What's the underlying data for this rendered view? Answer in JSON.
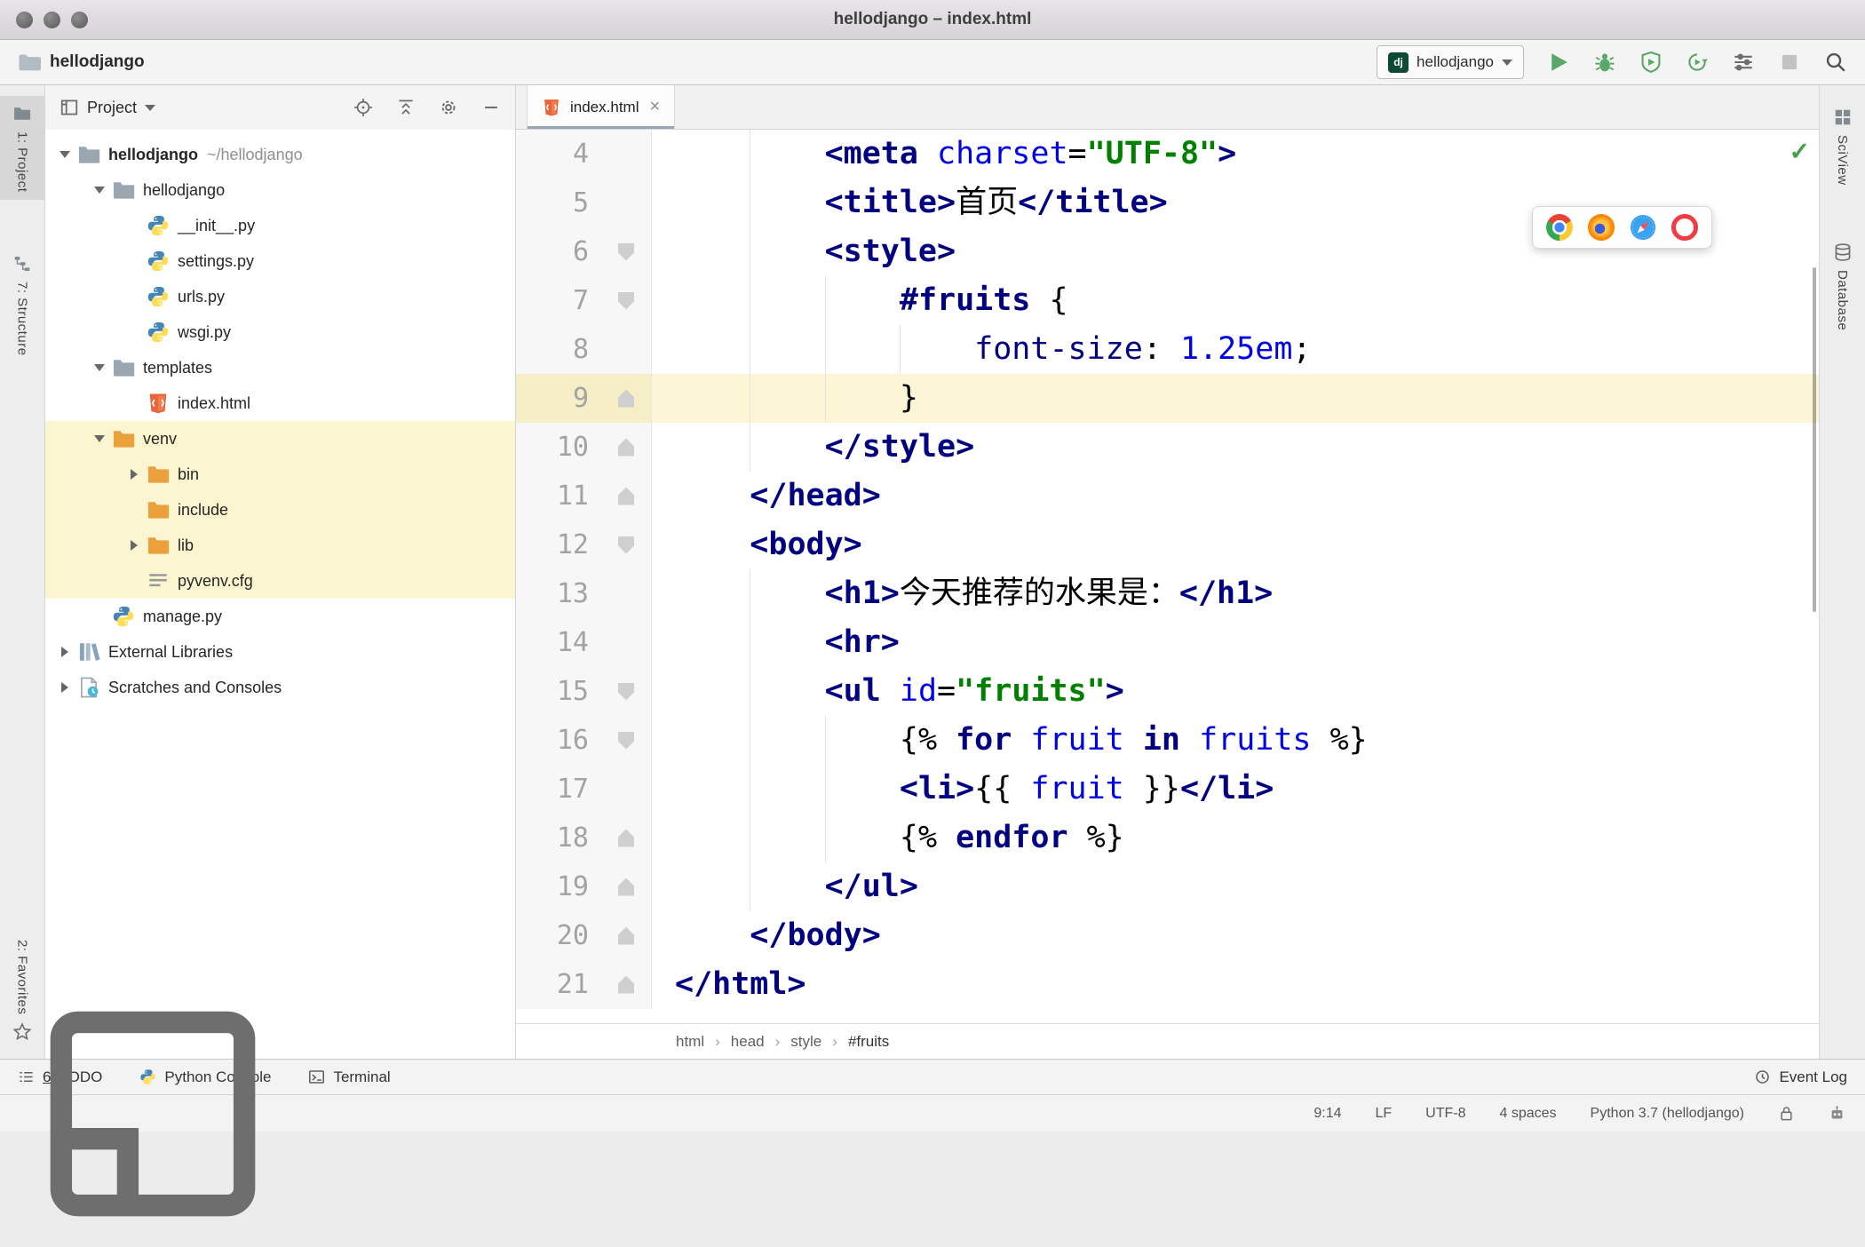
{
  "titlebar": {
    "title": "hellodjango – index.html"
  },
  "toolbar": {
    "project_name": "hellodjango",
    "run_config": {
      "label": "hellodjango",
      "badge": "dj"
    },
    "actions": [
      {
        "icon": "play",
        "name": "run-button"
      },
      {
        "icon": "debug",
        "name": "debug-button"
      },
      {
        "icon": "coverage",
        "name": "run-with-coverage-button"
      },
      {
        "icon": "profiler",
        "name": "profiler-button"
      },
      {
        "icon": "edit-configs",
        "name": "edit-configurations-button"
      },
      {
        "icon": "stop",
        "name": "stop-button",
        "disabled": true
      },
      {
        "icon": "search",
        "name": "search-everywhere-button"
      }
    ]
  },
  "left_strip": {
    "top": [
      {
        "icon": "project-tool",
        "label": "1: Project",
        "active": true
      },
      {
        "icon": "structure-tool",
        "label": "7: Structure"
      }
    ],
    "bottom": [
      {
        "icon": "star",
        "label": "2: Favorites",
        "icon_after": true
      }
    ]
  },
  "right_strip": {
    "items": [
      {
        "icon": "sciview-grid",
        "label": "SciView"
      },
      {
        "icon": "database",
        "label": "Database"
      }
    ]
  },
  "project_panel": {
    "header": {
      "title": "Project",
      "actions": [
        {
          "icon": "locate",
          "name": "locate-file-button"
        },
        {
          "icon": "collapse-all",
          "name": "collapse-all-button"
        },
        {
          "icon": "settings",
          "name": "settings-button"
        },
        {
          "icon": "hide",
          "name": "hide-panel-button"
        }
      ]
    },
    "tree": [
      {
        "label": "hellodjango",
        "suffix": "~/hellodjango",
        "icon": "folder",
        "level": 0,
        "arrow": "down",
        "bold": true
      },
      {
        "label": "hellodjango",
        "icon": "folder",
        "level": 1,
        "arrow": "down"
      },
      {
        "label": "__init__.py",
        "icon": "python",
        "level": 2
      },
      {
        "label": "settings.py",
        "icon": "python",
        "level": 2
      },
      {
        "label": "urls.py",
        "icon": "python",
        "level": 2
      },
      {
        "label": "wsgi.py",
        "icon": "python",
        "level": 2
      },
      {
        "label": "templates",
        "icon": "folder",
        "level": 1,
        "arrow": "down"
      },
      {
        "label": "index.html",
        "icon": "html",
        "level": 2
      },
      {
        "label": "venv",
        "icon": "folder-excluded",
        "level": 1,
        "arrow": "down",
        "highlight": true
      },
      {
        "label": "bin",
        "icon": "folder-excluded",
        "level": 2,
        "arrow": "right",
        "highlight": true
      },
      {
        "label": "include",
        "icon": "folder-excluded",
        "level": 2,
        "highlight": true
      },
      {
        "label": "lib",
        "icon": "folder-excluded",
        "level": 2,
        "arrow": "right",
        "highlight": true
      },
      {
        "label": "pyvenv.cfg",
        "icon": "config-file",
        "level": 2,
        "highlight": true
      },
      {
        "label": "manage.py",
        "icon": "python",
        "level": 1
      },
      {
        "label": "External Libraries",
        "icon": "libraries",
        "level": 0,
        "arrow": "right"
      },
      {
        "label": "Scratches and Consoles",
        "icon": "scratches",
        "level": 0,
        "arrow": "right"
      }
    ]
  },
  "editor": {
    "tab": {
      "label": "index.html",
      "icon": "html",
      "close_glyph": "×"
    },
    "current_line": 9,
    "inspection_ok_glyph": "✓",
    "browser_popup": [
      "chrome",
      "firefox",
      "safari",
      "opera"
    ],
    "breadcrumbs": [
      "html",
      "head",
      "style",
      "#fruits"
    ],
    "lines": [
      {
        "n": 4,
        "fold": null,
        "guides": [
          4
        ],
        "segs": [
          [
            "        ",
            "p"
          ],
          [
            "<meta",
            "t"
          ],
          [
            " ",
            "p"
          ],
          [
            "charset",
            "a"
          ],
          [
            "=",
            "p"
          ],
          [
            "\"UTF-8\"",
            "s"
          ],
          [
            ">",
            "t"
          ]
        ]
      },
      {
        "n": 5,
        "fold": null,
        "guides": [
          4
        ],
        "segs": [
          [
            "        ",
            "p"
          ],
          [
            "<title>",
            "t"
          ],
          [
            "首页",
            "p"
          ],
          [
            "</title>",
            "t"
          ]
        ]
      },
      {
        "n": 6,
        "fold": "down",
        "guides": [
          4
        ],
        "segs": [
          [
            "        ",
            "p"
          ],
          [
            "<style>",
            "t"
          ]
        ]
      },
      {
        "n": 7,
        "fold": "down",
        "guides": [
          4,
          8
        ],
        "segs": [
          [
            "            ",
            "p"
          ],
          [
            "#fruits",
            "sel"
          ],
          [
            " {",
            "p"
          ]
        ]
      },
      {
        "n": 8,
        "fold": null,
        "guides": [
          4,
          8,
          12
        ],
        "segs": [
          [
            "                ",
            "p"
          ],
          [
            "font-size",
            "prop"
          ],
          [
            ": ",
            "p"
          ],
          [
            "1.25em",
            "num"
          ],
          [
            ";",
            "p"
          ]
        ]
      },
      {
        "n": 9,
        "fold": "up",
        "guides": [
          4,
          8
        ],
        "segs": [
          [
            "            }",
            "p"
          ]
        ]
      },
      {
        "n": 10,
        "fold": "up",
        "guides": [
          4
        ],
        "segs": [
          [
            "        ",
            "p"
          ],
          [
            "</style>",
            "t"
          ]
        ]
      },
      {
        "n": 11,
        "fold": "up",
        "guides": [],
        "segs": [
          [
            "    ",
            "p"
          ],
          [
            "</head>",
            "t"
          ]
        ]
      },
      {
        "n": 12,
        "fold": "down",
        "guides": [],
        "segs": [
          [
            "    ",
            "p"
          ],
          [
            "<body>",
            "t"
          ]
        ]
      },
      {
        "n": 13,
        "fold": null,
        "guides": [
          4
        ],
        "segs": [
          [
            "        ",
            "p"
          ],
          [
            "<h1>",
            "t"
          ],
          [
            "今天推荐的水果是：",
            "p"
          ],
          [
            "</h1>",
            "t"
          ]
        ]
      },
      {
        "n": 14,
        "fold": null,
        "guides": [
          4
        ],
        "segs": [
          [
            "        ",
            "p"
          ],
          [
            "<hr>",
            "t"
          ]
        ]
      },
      {
        "n": 15,
        "fold": "down",
        "guides": [
          4
        ],
        "segs": [
          [
            "        ",
            "p"
          ],
          [
            "<ul",
            "t"
          ],
          [
            " ",
            "p"
          ],
          [
            "id",
            "a"
          ],
          [
            "=",
            "p"
          ],
          [
            "\"fruits\"",
            "s"
          ],
          [
            ">",
            "t"
          ]
        ]
      },
      {
        "n": 16,
        "fold": "down",
        "guides": [
          4,
          8
        ],
        "segs": [
          [
            "            ",
            "p"
          ],
          [
            "{% ",
            "p"
          ],
          [
            "for",
            "k"
          ],
          [
            " ",
            "p"
          ],
          [
            "fruit",
            "v"
          ],
          [
            " ",
            "p"
          ],
          [
            "in",
            "k"
          ],
          [
            " ",
            "p"
          ],
          [
            "fruits",
            "v"
          ],
          [
            " ",
            "p"
          ],
          [
            "%}",
            "p"
          ]
        ]
      },
      {
        "n": 17,
        "fold": null,
        "guides": [
          4,
          8
        ],
        "segs": [
          [
            "            ",
            "p"
          ],
          [
            "<li>",
            "t"
          ],
          [
            "{{ ",
            "p"
          ],
          [
            "fruit",
            "v"
          ],
          [
            " }}",
            "p"
          ],
          [
            "</li>",
            "t"
          ]
        ]
      },
      {
        "n": 18,
        "fold": "up",
        "guides": [
          4,
          8
        ],
        "segs": [
          [
            "            ",
            "p"
          ],
          [
            "{% ",
            "p"
          ],
          [
            "endfor",
            "k"
          ],
          [
            " ",
            "p"
          ],
          [
            "%}",
            "p"
          ]
        ]
      },
      {
        "n": 19,
        "fold": "up",
        "guides": [
          4
        ],
        "segs": [
          [
            "        ",
            "p"
          ],
          [
            "</ul>",
            "t"
          ]
        ]
      },
      {
        "n": 20,
        "fold": "up",
        "guides": [],
        "segs": [
          [
            "    ",
            "p"
          ],
          [
            "</body>",
            "t"
          ]
        ]
      },
      {
        "n": 21,
        "fold": "up",
        "guides": [],
        "segs": [
          [
            "</html>",
            "t"
          ]
        ]
      }
    ]
  },
  "bottom_bar": {
    "left": [
      {
        "icon": "todo-list",
        "label": "6: TODO",
        "mnemonic": true
      },
      {
        "icon": "python",
        "label": "Python Console"
      },
      {
        "icon": "terminal",
        "label": "Terminal"
      }
    ],
    "right": [
      {
        "icon": "event-log",
        "label": "Event Log"
      }
    ]
  },
  "status_bar": {
    "items": [
      "9:14",
      "LF",
      "UTF-8",
      "4 spaces",
      "Python 3.7 (hellodjango)"
    ]
  },
  "colors": {
    "accent_green": "#59a869",
    "tag": "#000080",
    "string": "#008000",
    "identifier": "#0000e6",
    "highlight_row": "#fbf5d0",
    "current_line": "#fcf5d6"
  }
}
